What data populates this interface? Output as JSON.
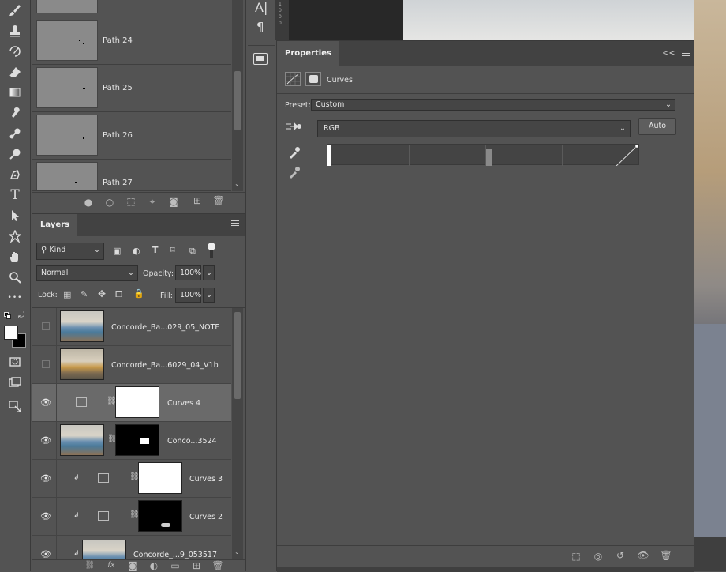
{
  "tools": {
    "icons": [
      "brush-icon",
      "stamp-icon",
      "history-brush-icon",
      "eraser-icon",
      "gradient-icon",
      "smudge-icon",
      "dodge-icon",
      "burn-icon",
      "pen-icon",
      "type-icon",
      "path-select-icon",
      "shape-icon",
      "hand-icon",
      "zoom-icon",
      "more-icon"
    ],
    "type_glyph": "T",
    "more_glyph": "•••"
  },
  "paths_panel": {
    "items": [
      {
        "label": ""
      },
      {
        "label": "Path 24"
      },
      {
        "label": "Path 25"
      },
      {
        "label": "Path 26"
      },
      {
        "label": "Path 27"
      }
    ]
  },
  "layers_panel": {
    "tab": "Layers",
    "filter": "Kind",
    "blend_mode": "Normal",
    "opacity_label": "Opacity:",
    "opacity_value": "100%",
    "lock_label": "Lock:",
    "fill_label": "Fill:",
    "fill_value": "100%",
    "layers": [
      {
        "name": "Concorde_Ba...029_05_NOTE",
        "visible": false
      },
      {
        "name": "Concorde_Ba...6029_04_V1b",
        "visible": false
      },
      {
        "name": "Curves 4",
        "visible": true,
        "selected": true
      },
      {
        "name": "Conco...3524",
        "visible": true
      },
      {
        "name": "Curves 3",
        "visible": true,
        "clipped": true
      },
      {
        "name": "Curves 2",
        "visible": true,
        "clipped": true
      },
      {
        "name": "Concorde_...9_053517",
        "visible": true,
        "clipped": true
      }
    ],
    "footer_fx": "fx"
  },
  "middle_strip": {
    "char_glyph": "A|",
    "para_glyph": "¶",
    "ruler_digits": "1 0 0 0"
  },
  "properties": {
    "tab": "Properties",
    "title": "Curves",
    "preset_label": "Preset:",
    "preset_value": "Custom",
    "channel": "RGB",
    "auto_label": "Auto",
    "collapse_glyph": "<<"
  }
}
